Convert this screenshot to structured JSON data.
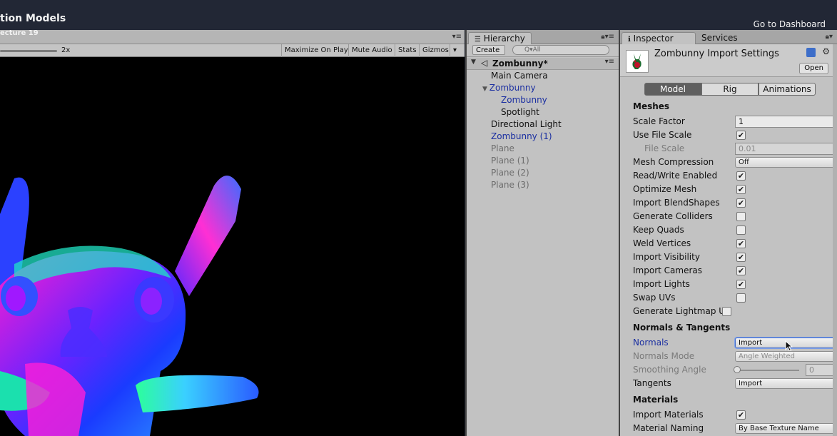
{
  "topbar": {
    "title": "tion Models",
    "subtitle": "ecture 19",
    "dashboard_link": "Go to Dashboard"
  },
  "game": {
    "zoom_label": "2x",
    "toolbar": [
      "Maximize On Play",
      "Mute Audio",
      "Stats",
      "Gizmos"
    ]
  },
  "hierarchy": {
    "tab": "Hierarchy",
    "create_label": "Create",
    "search_placeholder": "Q▾All",
    "scene": "Zombunny*",
    "items": [
      {
        "label": "Main Camera",
        "style": "normal"
      },
      {
        "label": "Zombunny",
        "style": "blue"
      },
      {
        "label": "Zombunny",
        "style": "blue"
      },
      {
        "label": "Spotlight",
        "style": "normal"
      },
      {
        "label": "Directional Light",
        "style": "normal"
      },
      {
        "label": "Zombunny (1)",
        "style": "blue"
      },
      {
        "label": "Plane",
        "style": "gray"
      },
      {
        "label": "Plane (1)",
        "style": "gray"
      },
      {
        "label": "Plane (2)",
        "style": "gray"
      },
      {
        "label": "Plane (3)",
        "style": "gray"
      }
    ]
  },
  "inspector": {
    "tab_inspector": "Inspector",
    "tab_services": "Services",
    "title": "Zombunny Import Settings",
    "open_label": "Open",
    "segments": [
      "Model",
      "Rig",
      "Animations"
    ],
    "sections": {
      "meshes": "Meshes",
      "normals": "Normals & Tangents",
      "materials": "Materials"
    },
    "rows": [
      {
        "label": "Scale Factor",
        "value": "1"
      },
      {
        "label": "Use File Scale",
        "checked": true
      },
      {
        "label": "File Scale",
        "value": "0.01"
      },
      {
        "label": "Mesh Compression",
        "value": "Off"
      },
      {
        "label": "Read/Write Enabled",
        "checked": true
      },
      {
        "label": "Optimize Mesh",
        "checked": true
      },
      {
        "label": "Import BlendShapes",
        "checked": true
      },
      {
        "label": "Generate Colliders",
        "checked": false
      },
      {
        "label": "Keep Quads",
        "checked": false
      },
      {
        "label": "Weld Vertices",
        "checked": true
      },
      {
        "label": "Import Visibility",
        "checked": true
      },
      {
        "label": "Import Cameras",
        "checked": true
      },
      {
        "label": "Import Lights",
        "checked": true
      },
      {
        "label": "Swap UVs",
        "checked": false
      },
      {
        "label": "Generate Lightmap UV",
        "checked": false
      },
      {
        "label": "Normals",
        "value": "Import"
      },
      {
        "label": "Normals Mode",
        "value": "Angle Weighted"
      },
      {
        "label": "Smoothing Angle",
        "value": "0"
      },
      {
        "label": "Tangents",
        "value": "Import"
      },
      {
        "label": "Import Materials",
        "checked": true
      },
      {
        "label": "Material Naming",
        "value": "By Base Texture Name"
      }
    ]
  }
}
